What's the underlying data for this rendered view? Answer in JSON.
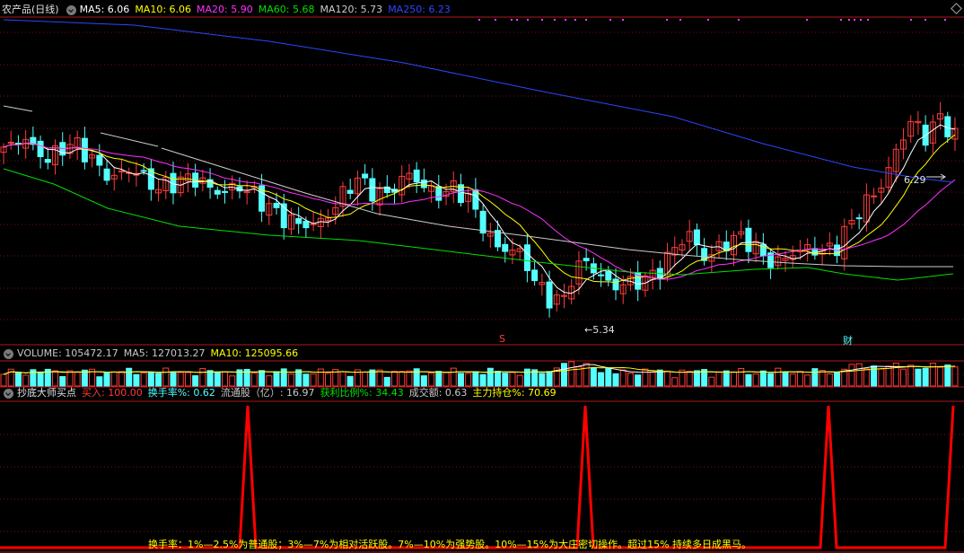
{
  "colors": {
    "up": "#ff3c3c",
    "down": "#54ffff",
    "ma5": "#ffffff",
    "ma10": "#ffff00",
    "ma20": "#ff30ff",
    "ma60": "#00e000",
    "ma120": "#cccccc",
    "ma250": "#2e46ff",
    "grid": "#7a1212",
    "frame": "#b01818",
    "signal": "#ff0000"
  },
  "price_header": {
    "title": "农产品(日线)",
    "items": [
      {
        "label": "MA5: 6.06",
        "color": "#ffffff"
      },
      {
        "label": "MA10: 6.06",
        "color": "#ffff00"
      },
      {
        "label": "MA20: 5.90",
        "color": "#ff30ff"
      },
      {
        "label": "MA60: 5.68",
        "color": "#00e000"
      },
      {
        "label": "MA120: 5.73",
        "color": "#cccccc"
      },
      {
        "label": "MA250: 6.23",
        "color": "#2e46ff"
      }
    ]
  },
  "volume_header": {
    "items": [
      {
        "label": "VOLUME: 105472.17",
        "color": "#c8c8c8"
      },
      {
        "label": "MA5: 127013.27",
        "color": "#c8c8c8"
      },
      {
        "label": "MA10: 125095.66",
        "color": "#ffff00"
      }
    ]
  },
  "indicator_header": {
    "title": "抄底大师买点",
    "items": [
      {
        "label": "买入: 100.00",
        "color": "#ff3c3c"
      },
      {
        "label": "换手率%: 0.62",
        "color": "#54ffff"
      },
      {
        "label": "流通股（亿）: 16.97",
        "color": "#c8c8c8"
      },
      {
        "label": "获利比例%: 34.43",
        "color": "#00e000"
      },
      {
        "label": "成交额: 0.63",
        "color": "#c8c8c8"
      },
      {
        "label": "主力持仓%: 70.69",
        "color": "#ffff00"
      }
    ]
  },
  "annotations": {
    "high_label": "6.29",
    "low_label": "5.34",
    "marker_s": "S",
    "marker_cai": "财"
  },
  "footer_text": "换手率：1%—2.5%为普通股；3%—7%为相对活跃股。7%—10%为强势股。10%—15%为大庄密切操作。超过15% 持续多日成黑马。",
  "chart_data": [
    {
      "type": "candlestick",
      "title": "农产品(日线)",
      "high": 6.29,
      "low": 5.34,
      "bar_count": 93,
      "moving_averages_last": {
        "MA5": 6.06,
        "MA10": 6.06,
        "MA20": 5.9,
        "MA60": 5.68,
        "MA120": 5.73,
        "MA250": 6.23
      }
    },
    {
      "type": "bar",
      "title": "VOLUME",
      "last": 105472.17,
      "MA5": 127013.27,
      "MA10": 125095.66
    },
    {
      "type": "line",
      "title": "抄底大师买点",
      "values_last": {
        "买入": 100.0,
        "换手率%": 0.62,
        "流通股（亿）": 16.97,
        "获利比例%": 34.43,
        "成交额": 0.63,
        "主力持仓%": 70.69
      },
      "signal_peaks": 4
    }
  ]
}
